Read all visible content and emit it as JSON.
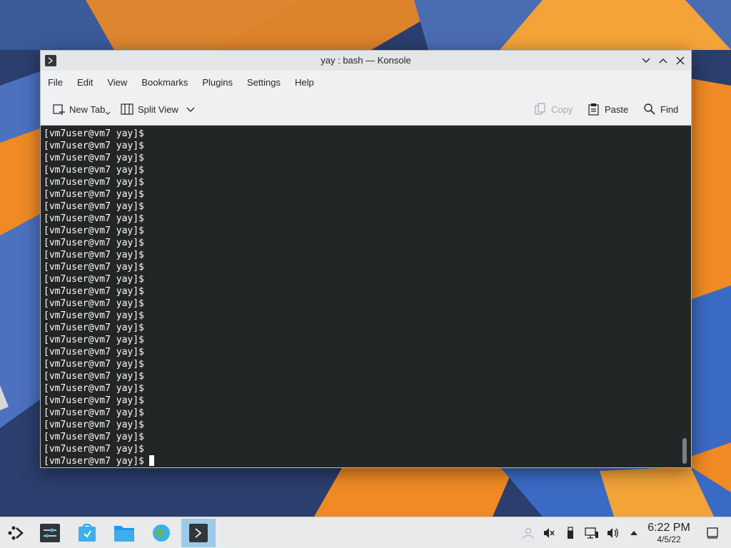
{
  "window": {
    "title": "yay : bash — Konsole"
  },
  "menu": [
    "File",
    "Edit",
    "View",
    "Bookmarks",
    "Plugins",
    "Settings",
    "Help"
  ],
  "toolbar": {
    "new_tab": "New Tab",
    "split_view": "Split View",
    "copy": "Copy",
    "paste": "Paste",
    "find": "Find"
  },
  "terminal": {
    "prompt": "[vm7user@vm7 yay]$",
    "line_count": 28
  },
  "taskbar": {
    "time": "6:22 PM",
    "date": "4/5/22"
  },
  "colors": {
    "terminal_bg": "#232627",
    "terminal_fg": "#fcfcfc",
    "accent": "#3daee9",
    "wallpaper_orange": "#f08a24"
  }
}
